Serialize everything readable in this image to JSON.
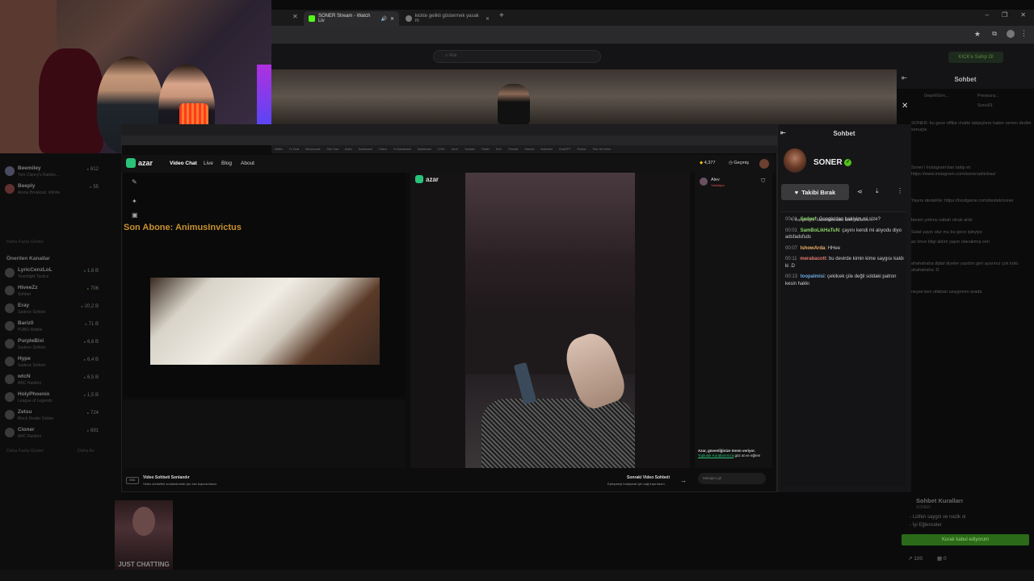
{
  "tabs": [
    {
      "label": "SONER Stream - Watch Liv",
      "active": true
    },
    {
      "label": "kickte gelikli göstermek yasak m",
      "active": false
    }
  ],
  "kick": {
    "search_placeholder": "Ara",
    "login_label": "KICK'e Sahip Ol",
    "chat_title": "Sohbet",
    "outer_top_users": [
      "Geprt6Grn...",
      "Pressura...",
      "Sonu01"
    ],
    "sidebar_section": "Önerilen Kanallar",
    "sidebar_more1": "Daha Fazla Göster",
    "sidebar_more2": "Daha Fazla Göster",
    "sidebar_more_right": "Daha Az",
    "followed": [
      {
        "name": "Beemiley",
        "game": "Tom Clancy's Rainbo...",
        "viewers": "612"
      },
      {
        "name": "Beeply",
        "game": "Arena Breakout: Infinite",
        "viewers": "55"
      }
    ],
    "recommended": [
      {
        "name": "LyricCenzLoL",
        "game": "Teamfight Tactics",
        "viewers": "1,6 B"
      },
      {
        "name": "HiveeZz",
        "game": "Sohbet",
        "viewers": "706"
      },
      {
        "name": "Eray",
        "game": "Sadece Sohbet",
        "viewers": "20,2 B"
      },
      {
        "name": "Bariz0",
        "game": "PUBG Mobile",
        "viewers": "71 B"
      },
      {
        "name": "PurpleBixi",
        "game": "Sadece Sohbet",
        "viewers": "6,6 B"
      },
      {
        "name": "Hype",
        "game": "Sadece Sohbet",
        "viewers": "6,4 B"
      },
      {
        "name": "wtcN",
        "game": "ARC Raiders",
        "viewers": "6,5 B"
      },
      {
        "name": "HolyPhoenix",
        "game": "League of Legends",
        "viewers": "1,5 B"
      },
      {
        "name": "Zetsu",
        "game": "Block Dealer Online",
        "viewers": "724"
      },
      {
        "name": "Cioner",
        "game": "ARC Raiders",
        "viewers": "691"
      }
    ],
    "outer_chat": [
      "SONER: bu gece offike chatte takipçilere haber verem dedim sonuçta",
      "Soner'ı Instagram'dan takip et: https://www.instagram.com/sonersahinbas/",
      "Yayını desteKle: https://tvodgame.com/destek/soner",
      "benim yokmu sabah olcak artık",
      "Salat yayın olur mu bu gece işleyiye",
      "az önce bilgi aldım yayın olacakmış sen",
      "ahahahaha dijital diyeler yazdım geri ayarınız çok kötü ahahahaha :D",
      "neyse ben ufaktan uzaypınım arada"
    ],
    "rules_title": "Sohbet Kuralları",
    "rules_sub": "SONER",
    "rules": [
      "- Lütfen saygılı ve nazik ol",
      "- İyi Eğlenceler"
    ],
    "rules_button": "Kuralı kabul ediyorum",
    "stats": {
      "likes": "100",
      "count": "0"
    }
  },
  "azar": {
    "logo": "azar",
    "nav": [
      "Video Chat",
      "Live",
      "Blog",
      "About"
    ],
    "gems": "4,377",
    "history": "Geçmiş",
    "overlay_title": "Son Abone: AnimusInvictus",
    "partner_name": "Alev",
    "partner_status": "Yakalayıc",
    "end_title": "Video Sohbeti Sonlandır",
    "end_sub": "Video sohbetini sonlandırmak için esc tuşuna basın.",
    "esc_key": "ESC",
    "next_title": "Sonraki Video Sohbeti",
    "next_sub": "Eşleşmeyi bulaşmak için sağ tuşa basın.",
    "msg_placeholder": "Mesajını gir",
    "safety_text": "Azar, güvenliğinize önem veriyor.",
    "safety_link": "Topluluk Kurallarımıza",
    "safety_tail": "göz at ve eğlen!"
  },
  "kick_chat": {
    "title": "Sohbet",
    "streamer": "SONER",
    "unfollow": "Takibi Bırak",
    "reply": "Rangeright: babababababa lalelli kullanıcı...",
    "messages": [
      {
        "t": "00:01",
        "user": "Sedeef",
        "color": "#8bd36a",
        "text": "Google'dan bakiyim mi size?"
      },
      {
        "t": "00:01",
        "user": "SamBoLikHaTuN",
        "color": "#8bd36a",
        "text": "çayını kendi mi alıyodu diyo adsfadsfsds"
      },
      {
        "t": "00:07",
        "user": "IshowArda",
        "color": "#f0b36a",
        "text": "HHee"
      },
      {
        "t": "00:11",
        "user": "merabacott",
        "color": "#e07a70",
        "text": "bu devirde kimin kime saygısı kaldı ki .D"
      },
      {
        "t": "00:13",
        "user": "toopalmisi",
        "color": "#6aa9e0",
        "text": "çekilcek çile değil soldaki patron kesin hakkı"
      }
    ]
  },
  "bookmarks": [
    "Netflix",
    "Tv Chat",
    "Nexusmods",
    "Dizi Chat",
    "Kodin",
    "Dashboard",
    "Twitch",
    "Yo Dashboard",
    "Dashboard",
    "LYNX",
    "Çevir",
    "Youtube",
    "Twitter",
    "Kick",
    "Threads",
    "Discord",
    "Bolumleri",
    "ChatGPT",
    "Roblox",
    "Tüm Yer İmleri"
  ],
  "video_tile_label": "JUST CHATTING",
  "colors": {
    "kick_green": "#53fc18",
    "azar_green": "#29c47a",
    "accent_gold": "#c8912f"
  }
}
